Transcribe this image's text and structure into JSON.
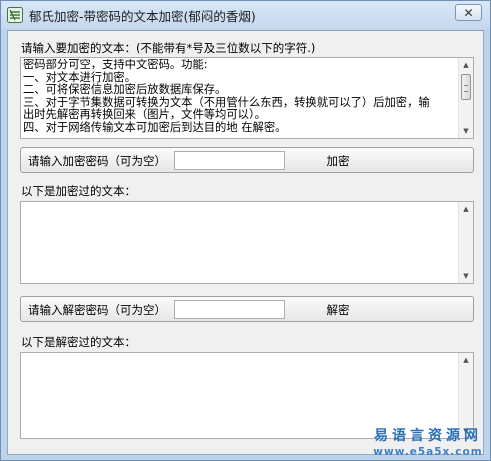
{
  "window": {
    "title": "郁氏加密-带密码的文本加密(郁闷的香烟)",
    "close_glyph": "✕"
  },
  "plain_text": {
    "label": "请输入要加密的文本：(不能带有*号及三位数以下的字符.)",
    "value": "密码部分可空，支持中文密码。功能:\n一、对文本进行加密。\n二、可将保密信息加密后放数据库保存。\n三、对于字节集数据可转换为文本（不用管什么东西，转换就可以了）后加密，输\n出时先解密再转换回来（图片，文件等均可以）。\n四、对于网络传输文本可加密后到达目的地 在解密。"
  },
  "encrypt_bar": {
    "label": "请输入加密密码（可为空）",
    "password_value": "",
    "button_label": "加密"
  },
  "encrypted_text": {
    "label": "以下是加密过的文本：",
    "value": ""
  },
  "decrypt_bar": {
    "label": "请输入解密密码（可为空）",
    "password_value": "",
    "button_label": "解密"
  },
  "decrypted_text": {
    "label": "以下是解密过的文本：",
    "value": ""
  },
  "watermark": {
    "line1": "易语言资源网",
    "line2": "www.e5a5x.com"
  },
  "colors": {
    "title_bar": "#c3d7ed",
    "client_bg": "#f0f0f0",
    "watermark": "#2a6fb8"
  }
}
